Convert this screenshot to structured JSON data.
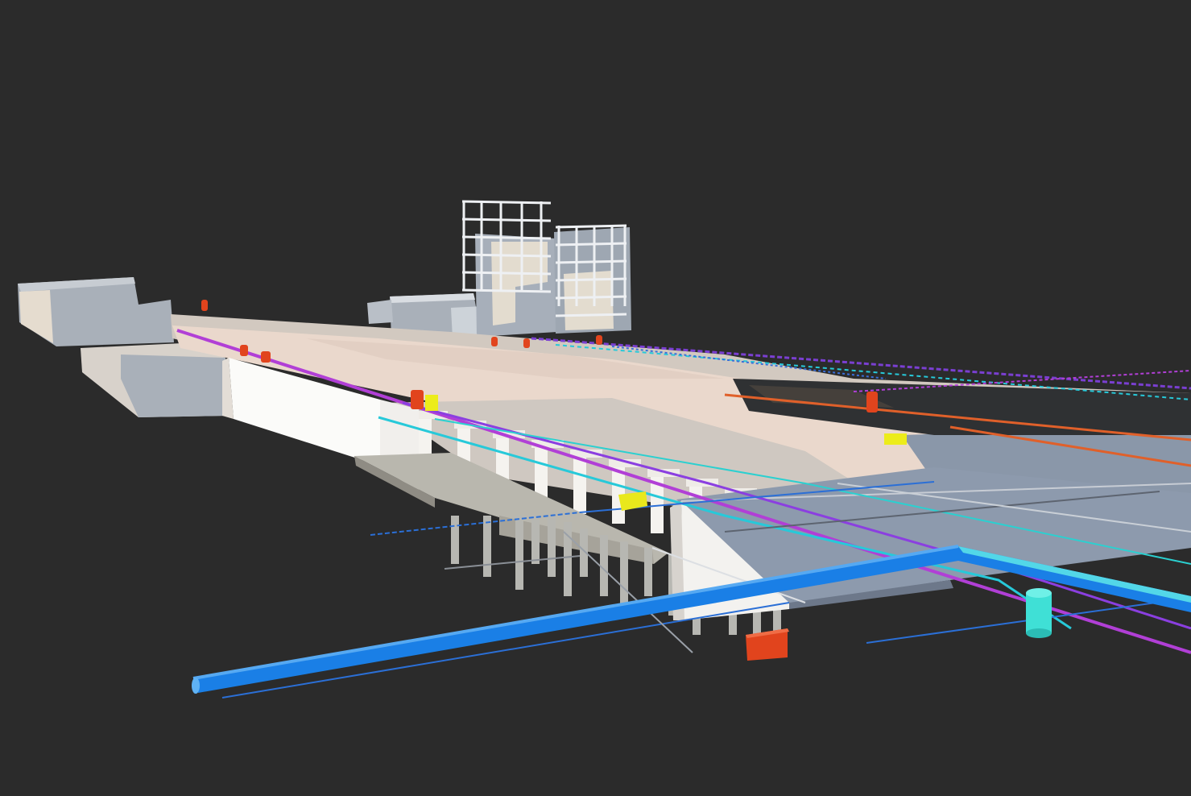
{
  "scene": {
    "kind": "3D BIM model render of an underground transit station with utility pipelines",
    "background_color": "#2b2b2b",
    "colors": {
      "structure_light": "#f3ece6",
      "structure_roof": "#ead5c8",
      "structure_wall": "#fbfbf9",
      "structure_shadow": "#c8c2bc",
      "slab_grey_blue": "#8c9aad",
      "building_grey": "#a7afba",
      "building_frame": "#e9ecef",
      "pile_grey": "#b7b7b2",
      "water_main_blue": "#1a7fe6",
      "pipe_cyan": "#27c9d9",
      "pipe_magenta": "#b13fd6",
      "pipe_purple": "#7a3fd1",
      "pipe_orange": "#e0602a",
      "marker_yellow": "#ecec1a",
      "marker_red": "#e1441d",
      "manhole_cyan": "#3fe0d6"
    },
    "elements": [
      "station-box",
      "station-roof-slab",
      "open-cut-section",
      "end-slab",
      "pile-foundation",
      "existing-buildings",
      "under-construction-tower-frames",
      "water-main-pipe",
      "utility-pipelines",
      "fitting-markers",
      "cyan-manhole-cylinder",
      "red-valve-box"
    ]
  }
}
